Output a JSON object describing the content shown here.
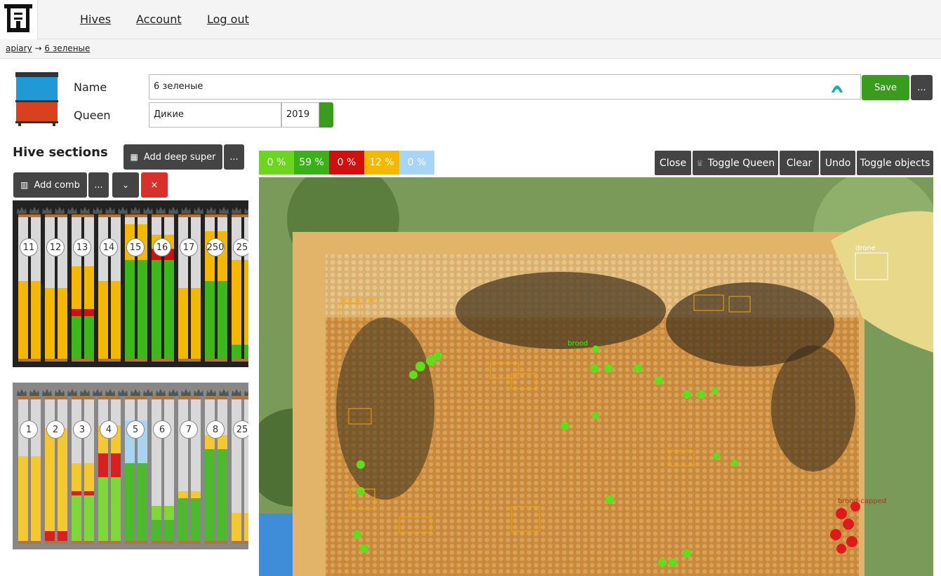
{
  "nav": {
    "hives": "Hives",
    "account": "Account",
    "logout": "Log out"
  },
  "breadcrumb": {
    "root": "apiary",
    "arrow": "→",
    "current": "6 зеленые"
  },
  "form": {
    "name_label": "Name",
    "name_value": "6 зеленые",
    "queen_label": "Queen",
    "queen_value": "Дикие",
    "queen_year": "2019",
    "save_label": "Save",
    "more_label": "..."
  },
  "sections": {
    "title": "Hive sections",
    "add_deep_super": "Add deep super",
    "add_comb": "Add comb",
    "more": "...",
    "close": "×"
  },
  "box1_frames": [
    {
      "n": "11",
      "fills": [
        [
          "#f5b800",
          0.55
        ]
      ]
    },
    {
      "n": "12",
      "fills": [
        [
          "#f5b800",
          0.5
        ]
      ]
    },
    {
      "n": "13",
      "fills": [
        [
          "#3db81a",
          0.3
        ],
        [
          "#d01010",
          0.05
        ],
        [
          "#f5b800",
          0.3
        ]
      ]
    },
    {
      "n": "14",
      "fills": [
        [
          "#f5b800",
          0.55
        ]
      ]
    },
    {
      "n": "15",
      "fills": [
        [
          "#3db81a",
          0.7
        ],
        [
          "#f5b800",
          0.25
        ]
      ]
    },
    {
      "n": "16",
      "fills": [
        [
          "#3db81a",
          0.7
        ],
        [
          "#d01010",
          0.08
        ],
        [
          "#f5b800",
          0.1
        ]
      ]
    },
    {
      "n": "17",
      "fills": [
        [
          "#f5b800",
          0.5
        ]
      ]
    },
    {
      "n": "250",
      "fills": [
        [
          "#3db81a",
          0.55
        ],
        [
          "#f5b800",
          0.35
        ]
      ]
    },
    {
      "n": "25",
      "fills": [
        [
          "#3db81a",
          0.1
        ],
        [
          "#f5b800",
          0.6
        ]
      ]
    }
  ],
  "box2_frames": [
    {
      "n": "1",
      "fills": [
        [
          "#f5c830",
          0.6
        ]
      ]
    },
    {
      "n": "2",
      "fills": [
        [
          "#d82020",
          0.07
        ],
        [
          "#f5c830",
          0.73
        ]
      ]
    },
    {
      "n": "3",
      "fills": [
        [
          "#7dd838",
          0.32
        ],
        [
          "#d82020",
          0.03
        ],
        [
          "#f5c830",
          0.2
        ]
      ]
    },
    {
      "n": "4",
      "fills": [
        [
          "#7dd838",
          0.45
        ],
        [
          "#d82020",
          0.17
        ],
        [
          "#f5c830",
          0.2
        ]
      ]
    },
    {
      "n": "5",
      "fills": [
        [
          "#4cba2a",
          0.55
        ],
        [
          "#a8d4f0",
          0.3
        ]
      ]
    },
    {
      "n": "6",
      "fills": [
        [
          "#4cba2a",
          0.15
        ],
        [
          "#7dd838",
          0.1
        ]
      ]
    },
    {
      "n": "7",
      "fills": [
        [
          "#4cba2a",
          0.3
        ],
        [
          "#f5c830",
          0.05
        ]
      ]
    },
    {
      "n": "8",
      "fills": [
        [
          "#4cba2a",
          0.65
        ],
        [
          "#f5c830",
          0.1
        ]
      ]
    },
    {
      "n": "25",
      "fills": [
        [
          "#f5c830",
          0.2
        ]
      ]
    }
  ],
  "stats": [
    {
      "label": "0 %",
      "color": "#6cd61f"
    },
    {
      "label": "59 %",
      "color": "#3ab01a"
    },
    {
      "label": "0 %",
      "color": "#d01010"
    },
    {
      "label": "12 %",
      "color": "#f5b800"
    },
    {
      "label": "0 %",
      "color": "#a8d4f5"
    }
  ],
  "toolbar": {
    "close": "Close",
    "toggle_queen": "Toggle Queen",
    "clear": "Clear",
    "undo": "Undo",
    "toggle_objects": "Toggle objects"
  },
  "detections": [
    "drone",
    "bee-worker",
    "brood",
    "brood-capped"
  ]
}
